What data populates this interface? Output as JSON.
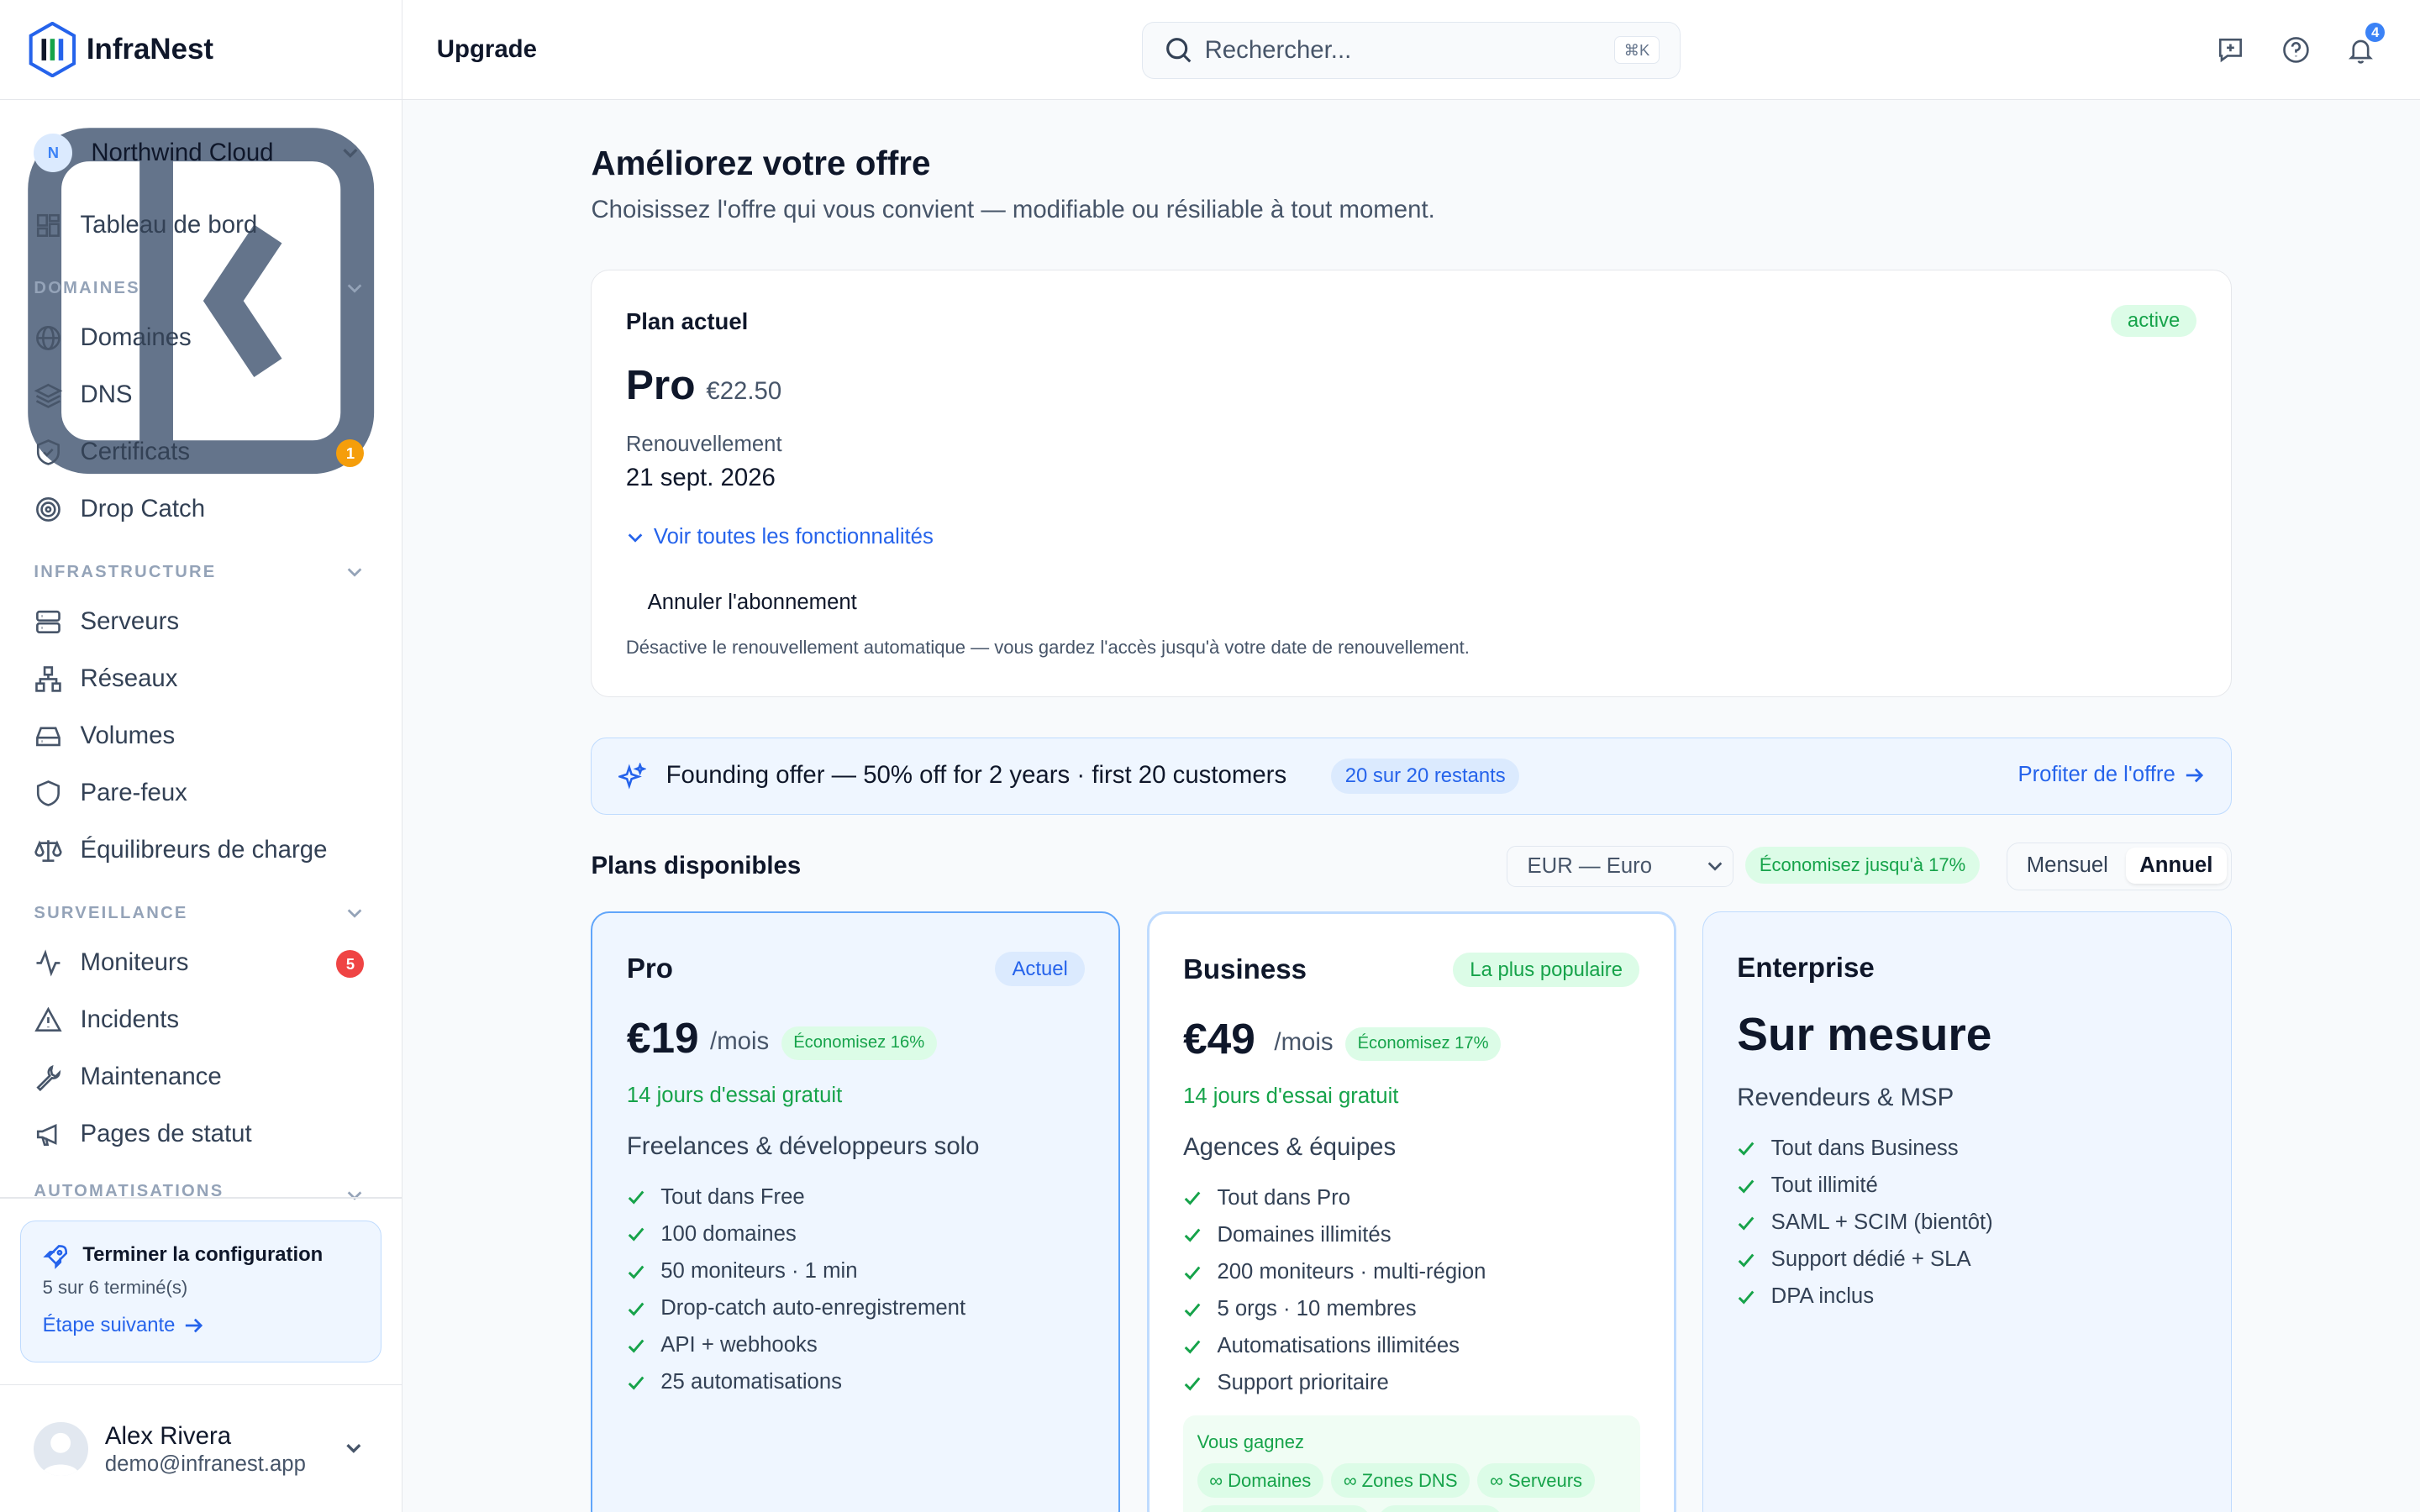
{
  "brand": {
    "name": "InfraNest"
  },
  "org": {
    "initial": "N",
    "name": "Northwind Cloud"
  },
  "nav": {
    "dashboard": "Tableau de bord",
    "sections": {
      "domains": "DOMAINES",
      "infra": "INFRASTRUCTURE",
      "monitoring": "SURVEILLANCE",
      "automation": "AUTOMATISATIONS"
    },
    "domains": "Domaines",
    "dns": "DNS",
    "certs": "Certificats",
    "certs_badge": "1",
    "dropcatch": "Drop Catch",
    "servers": "Serveurs",
    "networks": "Réseaux",
    "volumes": "Volumes",
    "firewalls": "Pare-feux",
    "lb": "Équilibreurs de charge",
    "monitors": "Moniteurs",
    "monitors_badge": "5",
    "incidents": "Incidents",
    "maintenance": "Maintenance",
    "status_pages": "Pages de statut"
  },
  "setup": {
    "title": "Terminer la configuration",
    "progress": "5 sur 6 terminé(s)",
    "next": "Étape suivante"
  },
  "user": {
    "name": "Alex Rivera",
    "email": "demo@infranest.app"
  },
  "topbar": {
    "title": "Upgrade",
    "search_placeholder": "Rechercher...",
    "shortcut": "⌘K",
    "notifications": "4"
  },
  "page": {
    "title": "Améliorez votre offre",
    "subtitle": "Choisissez l'offre qui vous convient — modifiable ou résiliable à tout moment."
  },
  "current_plan": {
    "label": "Plan actuel",
    "status": "active",
    "name": "Pro",
    "price": "€22.50",
    "renewal_label": "Renouvellement",
    "renewal_date": "21 sept. 2026",
    "features_link": "Voir toutes les fonctionnalités",
    "cancel_label": "Annuler l'abonnement",
    "cancel_desc": "Désactive le renouvellement automatique — vous gardez l'accès jusqu'à votre date de renouvellement."
  },
  "offer": {
    "text": "Founding offer — 50% off for 2 years · first 20 customers",
    "remaining": "20 sur 20 restants",
    "cta": "Profiter de l'offre"
  },
  "plans_header": {
    "title": "Plans disponibles",
    "currency": "EUR — Euro",
    "save": "Économisez jusqu'à 17%",
    "monthly": "Mensuel",
    "annual": "Annuel",
    "selected": "Annuel"
  },
  "plans": [
    {
      "name": "Pro",
      "tag": "Actuel",
      "price": "€19",
      "per": "/mois",
      "save": "Économisez 16%",
      "trial": "14 jours d'essai gratuit",
      "audience": "Freelances & développeurs solo",
      "features": [
        "Tout dans Free",
        "100 domaines",
        "50 moniteurs · 1 min",
        "Drop-catch auto-enregistrement",
        "API + webhooks",
        "25 automatisations"
      ]
    },
    {
      "name": "Business",
      "tag": "La plus populaire",
      "price": "€49",
      "per": "/mois",
      "save": "Économisez 17%",
      "trial": "14 jours d'essai gratuit",
      "audience": "Agences & équipes",
      "features": [
        "Tout dans Pro",
        "Domaines illimités",
        "200 moniteurs · multi-région",
        "5 orgs · 10 membres",
        "Automatisations illimitées",
        "Support prioritaire"
      ],
      "gain_title": "Vous gagnez",
      "gains": [
        "∞ Domaines",
        "∞ Zones DNS",
        "∞ Serveurs",
        "∞ Automatisations",
        "∞ Moniteurs"
      ]
    },
    {
      "name": "Enterprise",
      "price_label": "Sur mesure",
      "audience": "Revendeurs & MSP",
      "features": [
        "Tout dans Business",
        "Tout illimité",
        "SAML + SCIM (bientôt)",
        "Support dédié + SLA",
        "DPA inclus"
      ]
    }
  ],
  "colors": {
    "accent": "#2563eb",
    "success": "#16a34a",
    "warning": "#f59e0b",
    "danger": "#ef4444"
  }
}
